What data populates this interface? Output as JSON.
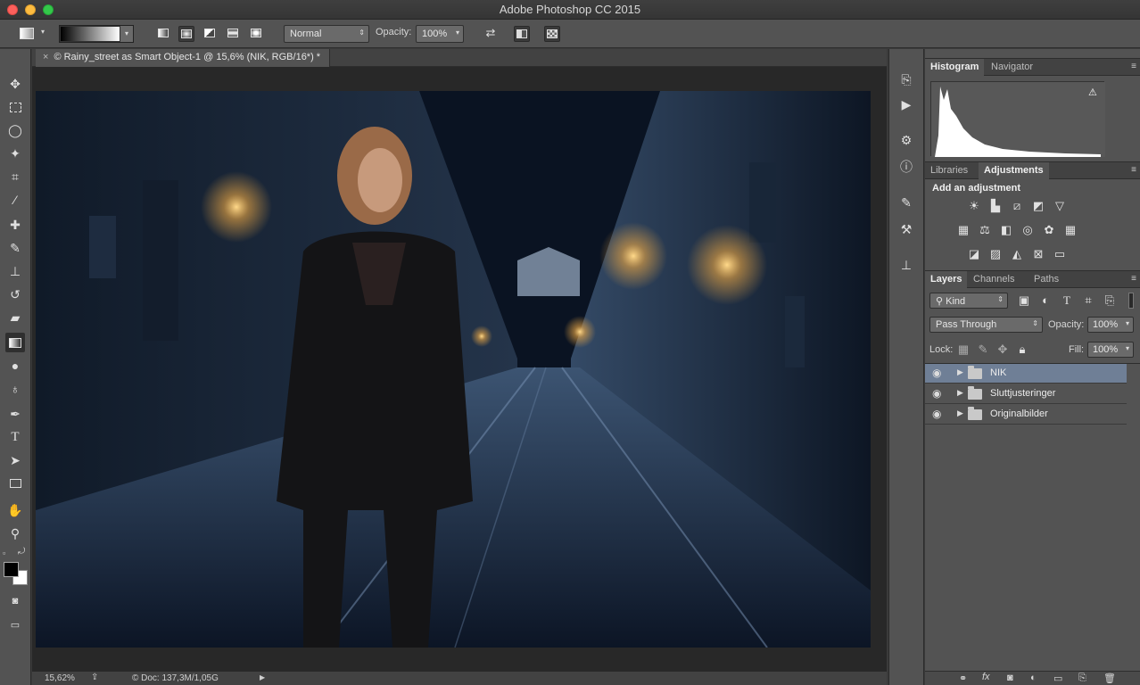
{
  "window": {
    "title": "Adobe Photoshop CC 2015"
  },
  "options_bar": {
    "mode": "Normal",
    "opacity_label": "Opacity:",
    "opacity": "100%"
  },
  "document": {
    "tab_title": "© Rainy_street as Smart Object-1 @ 15,6% (NIK, RGB/16*) *",
    "zoom": "15,62%",
    "doc_info": "© Doc: 137,3M/1,05G"
  },
  "panels": {
    "top_tabs": [
      "Histogram",
      "Navigator"
    ],
    "adj_tabs": [
      "Libraries",
      "Adjustments"
    ],
    "add_adjustment": "Add an adjustment",
    "layer_tabs": [
      "Layers",
      "Channels",
      "Paths"
    ],
    "filter_kind": "Kind",
    "blend_mode": "Pass Through",
    "opacity_label": "Opacity:",
    "opacity": "100%",
    "lock_label": "Lock:",
    "fill_label": "Fill:",
    "fill": "100%"
  },
  "layers": [
    {
      "name": "NIK",
      "selected": true
    },
    {
      "name": "Sluttjusteringer",
      "selected": false
    },
    {
      "name": "Originalbilder",
      "selected": false
    }
  ],
  "colors": {
    "accent_selection": "#6f7f96",
    "panel_bg": "#535353",
    "foreground": "#000000",
    "background": "#ffffff"
  }
}
